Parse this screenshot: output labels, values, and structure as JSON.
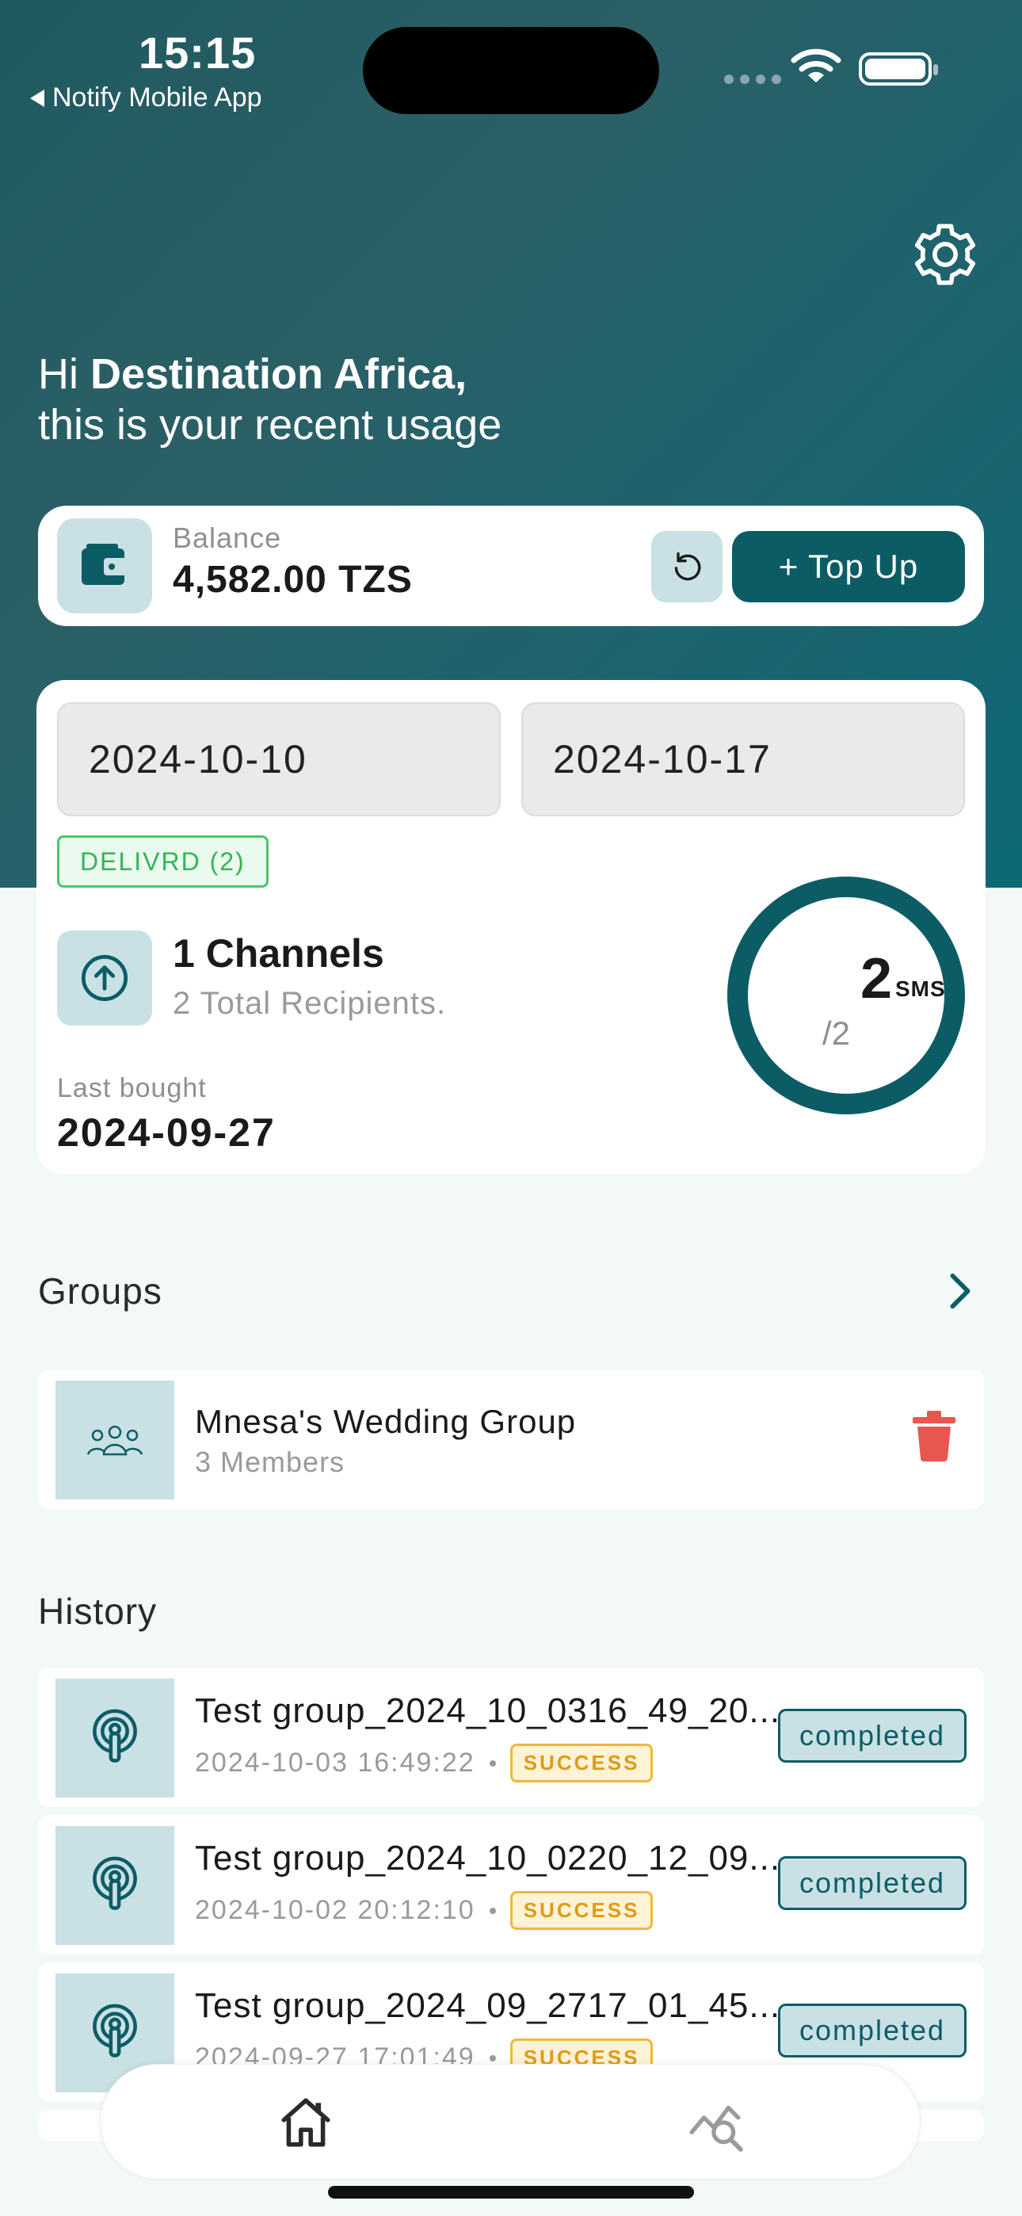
{
  "status_bar": {
    "time": "15:15",
    "back_app": "Notify Mobile App"
  },
  "greeting": {
    "prefix": "Hi ",
    "name": "Destination Africa,",
    "subtitle": "this is your recent usage"
  },
  "balance": {
    "label": "Balance",
    "value": "4,582.00 TZS",
    "topup_label": "+ Top Up"
  },
  "usage": {
    "date_from": "2024-10-10",
    "date_to": "2024-10-17",
    "delivered_chip": "DELIVRD (2)",
    "channels": "1 Channels",
    "recipients": "2 Total Recipients.",
    "last_bought_label": "Last bought",
    "last_bought_value": "2024-09-27",
    "sms_used": "2",
    "sms_unit": "SMS",
    "sms_total": "/2"
  },
  "groups": {
    "title": "Groups",
    "items": [
      {
        "name": "Mnesa's Wedding Group",
        "members": "3 Members"
      }
    ]
  },
  "history": {
    "title": "History",
    "items": [
      {
        "name": "Test group_2024_10_0316_49_20...",
        "timestamp": "2024-10-03 16:49:22",
        "result": "SUCCESS",
        "status": "completed"
      },
      {
        "name": "Test group_2024_10_0220_12_09...",
        "timestamp": "2024-10-02 20:12:10",
        "result": "SUCCESS",
        "status": "completed"
      },
      {
        "name": "Test group_2024_09_2717_01_45...",
        "timestamp": "2024-09-27 17:01:49",
        "result": "SUCCESS",
        "status": "completed"
      }
    ]
  },
  "colors": {
    "brand": "#0c5c66",
    "accent_light": "#c9e1e4",
    "success": "#35b457",
    "warning": "#e09a16",
    "danger": "#e85650"
  },
  "icons": {
    "settings": "gear-icon",
    "wallet": "wallet-icon",
    "refresh": "refresh-icon",
    "channel": "upload-arrow-icon",
    "group": "people-icon",
    "delete": "trash-icon",
    "history": "broadcast-icon",
    "nav_home": "home-icon",
    "nav_analytics": "analytics-icon"
  }
}
